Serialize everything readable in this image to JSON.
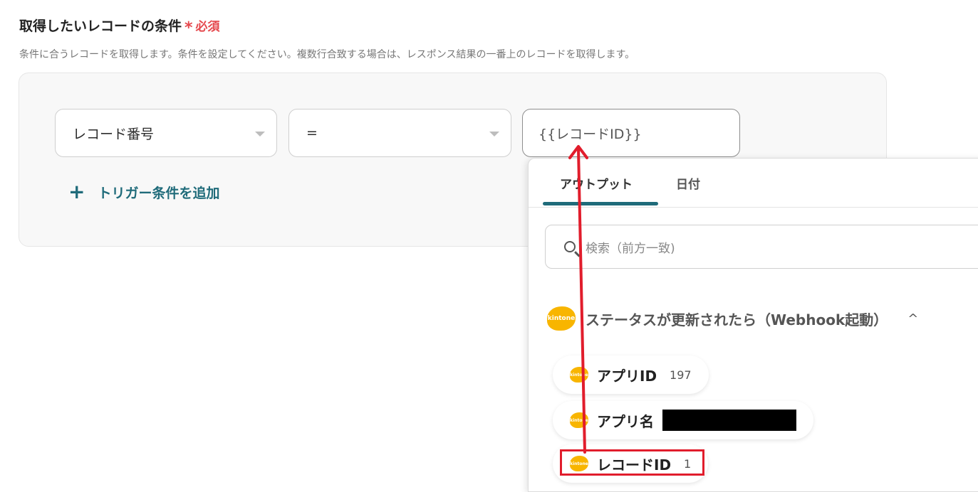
{
  "section": {
    "title": "取得したいレコードの条件",
    "required_star": "*",
    "required_label": "必須",
    "description": "条件に合うレコードを取得します。条件を設定してください。複数行合致する場合は、レスポンス結果の一番上のレコードを取得します。"
  },
  "condition": {
    "field_select": "レコード番号",
    "operator_select": "=",
    "value_input": "{{レコードID}}"
  },
  "add_trigger": {
    "plus": "+",
    "label": "トリガー条件を追加"
  },
  "dropdown": {
    "tabs": [
      {
        "label": "アウトプット",
        "active": true
      },
      {
        "label": "日付",
        "active": false
      }
    ],
    "search_placeholder": "検索（前方一致)",
    "group": {
      "logo_text": "kintone",
      "title": "ステータスが更新されたら（Webhook起動）",
      "chevron": "^"
    },
    "items": [
      {
        "logo_text": "kintone",
        "label": "アプリID",
        "value": "197"
      },
      {
        "logo_text": "kintone",
        "label": "アプリ名",
        "value": ""
      },
      {
        "logo_text": "kintone",
        "label": "レコードID",
        "value": "1"
      }
    ]
  },
  "colors": {
    "accent": "#1f6b7a",
    "required": "#e5484d",
    "annotation": "#e11d2c",
    "kintone": "#f8b500"
  }
}
